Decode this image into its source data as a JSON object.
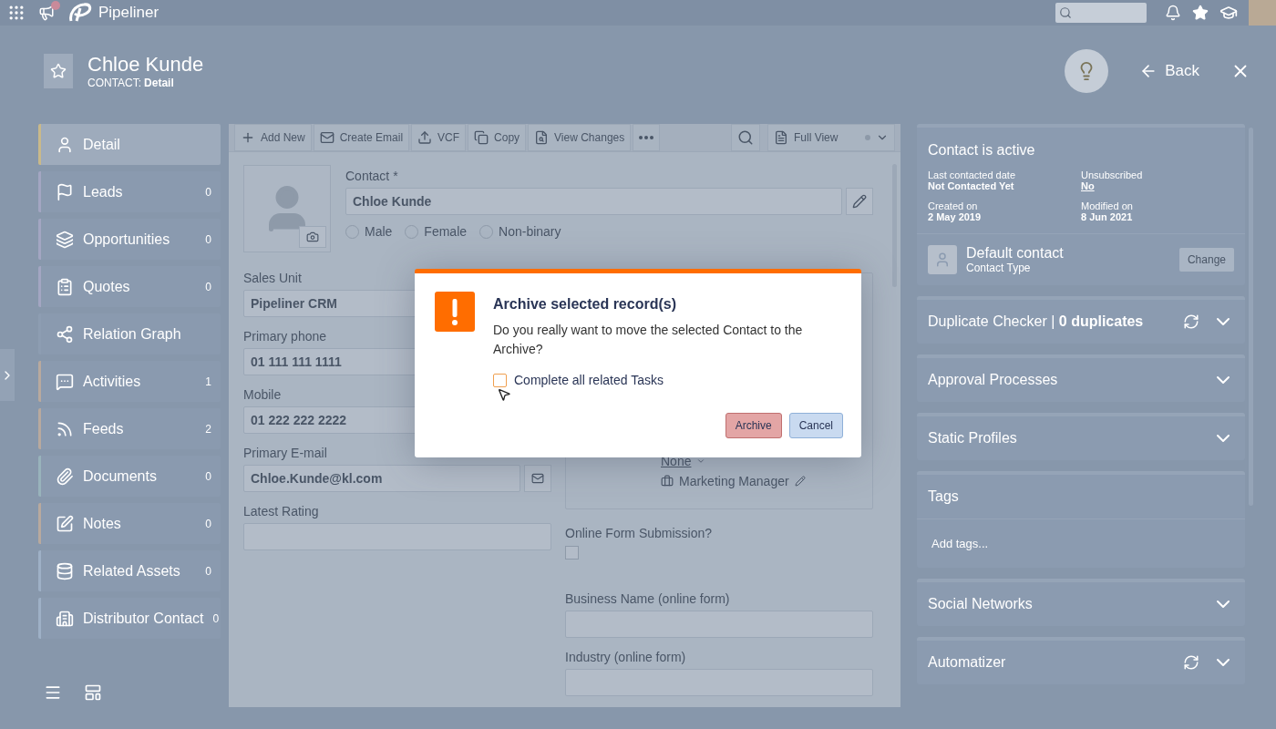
{
  "top_bar": {
    "app_name": "Pipeliner",
    "has_notification": true
  },
  "header": {
    "title": "Chloe Kunde",
    "entity": "CONTACT:",
    "view": "Detail",
    "back": "Back"
  },
  "sidebar": {
    "items": [
      {
        "label": "Detail",
        "selected": true,
        "color": "#c9b98a"
      },
      {
        "label": "Leads",
        "count": "0",
        "selected": false,
        "color": "#a3a6c2"
      },
      {
        "label": "Opportunities",
        "count": "0",
        "selected": false,
        "color": "#a3a6c2"
      },
      {
        "label": "Quotes",
        "count": "0",
        "selected": false,
        "color": "#a3a6c2"
      },
      {
        "label": "Relation Graph",
        "selected": false,
        "color": "#8d9db2"
      },
      {
        "label": "Activities",
        "count": "1",
        "selected": false,
        "color": "#b8a99e"
      },
      {
        "label": "Feeds",
        "count": "2",
        "selected": false,
        "color": "#b8a99e"
      },
      {
        "label": "Documents",
        "count": "0",
        "selected": false,
        "color": "#98b3bb"
      },
      {
        "label": "Notes",
        "count": "0",
        "selected": false,
        "color": "#b8a99e"
      },
      {
        "label": "Related Assets",
        "count": "0",
        "selected": false,
        "color": "#9eb0c6"
      },
      {
        "label": "Distributor Contact",
        "count": "0",
        "selected": false,
        "color": "#9eb0c6"
      }
    ]
  },
  "toolbar": {
    "actions": [
      "Add New",
      "Create Email",
      "VCF",
      "Copy",
      "View Changes"
    ],
    "view": "Full View"
  },
  "contact": {
    "label": "Contact *",
    "value": "Chloe Kunde",
    "genders": [
      {
        "label": "Male",
        "selected": false
      },
      {
        "label": "Female",
        "selected": false
      },
      {
        "label": "Non-binary",
        "selected": false
      }
    ]
  },
  "fields_left": [
    {
      "label": "Sales Unit",
      "value": "Pipeliner CRM",
      "kind": "text"
    },
    {
      "label": "Primary phone",
      "value": "01 111 111 1111",
      "kind": "text"
    },
    {
      "label": "Mobile",
      "value": "01 222 222 2222",
      "kind": "text"
    },
    {
      "label": "Primary E-mail",
      "value": "Chloe.Kunde@kl.com",
      "kind": "email"
    },
    {
      "label": "Latest Rating",
      "kind": "text"
    }
  ],
  "role_box": {
    "items": [
      {
        "kind": "dropdown",
        "text": "None"
      },
      {
        "kind": "editable",
        "text": "Marketing Manager"
      }
    ]
  },
  "online_form": {
    "label": "Online Form Submission?",
    "checked": false
  },
  "fields_right": [
    {
      "label": "Business Name (online form)"
    },
    {
      "label": "Industry (online form)"
    }
  ],
  "right_panel": {
    "status": "Contact is active",
    "info": [
      {
        "label": "Last contacted date",
        "value": "Not Contacted Yet",
        "kind": "text"
      },
      {
        "label": "Unsubscribed",
        "value": "No",
        "kind": "link"
      },
      {
        "label": "Created on",
        "value": "2 May 2019",
        "kind": "text"
      },
      {
        "label": "Modified on",
        "value": "8 Jun 2021",
        "kind": "text"
      }
    ],
    "contact_type": {
      "name": "Default contact",
      "caption": "Contact Type",
      "button": "Change"
    },
    "sections": [
      {
        "title": "Duplicate Checker  |  **0 duplicates**",
        "kind": "collapsible",
        "refresh": true
      },
      {
        "title": "Approval Processes",
        "kind": "collapsible",
        "refresh": false
      },
      {
        "title": "Static Profiles",
        "kind": "collapsible",
        "refresh": false
      },
      {
        "title": "Tags",
        "kind": "tags",
        "placeholder": "Add tags..."
      },
      {
        "title": "Social Networks",
        "kind": "collapsible",
        "refresh": false
      },
      {
        "title": "Automatizer",
        "kind": "collapsible",
        "refresh": true
      }
    ]
  },
  "dialog": {
    "title": "Archive selected record(s)",
    "message": "Do you really want to move the selected Contact to the Archive?",
    "checkbox": {
      "label": "Complete all related Tasks",
      "checked": false
    },
    "buttons": [
      {
        "label": "Archive",
        "kind": "danger"
      },
      {
        "label": "Cancel",
        "kind": "secondary"
      }
    ]
  }
}
